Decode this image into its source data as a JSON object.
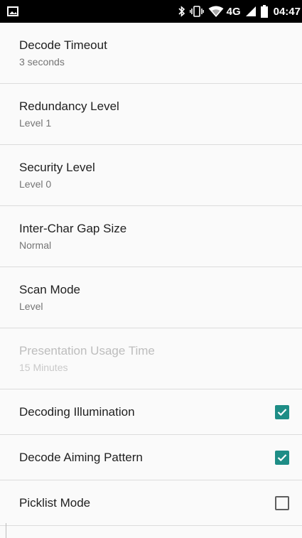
{
  "status_bar": {
    "network_label": "4G",
    "time": "04:47",
    "icons": [
      "image-notification-icon",
      "bluetooth-icon",
      "vibrate-icon",
      "wifi-icon",
      "cell-signal-icon",
      "battery-icon"
    ]
  },
  "colors": {
    "accent": "#1e8d86",
    "title": "#212121",
    "summary": "#757575",
    "disabled": "#bdbdbd",
    "divider": "#dcdcdc"
  },
  "preferences": [
    {
      "title": "Decode Timeout",
      "summary": "3 seconds",
      "enabled": true
    },
    {
      "title": "Redundancy Level",
      "summary": "Level 1",
      "enabled": true
    },
    {
      "title": "Security Level",
      "summary": "Level 0",
      "enabled": true
    },
    {
      "title": "Inter-Char Gap Size",
      "summary": "Normal",
      "enabled": true
    },
    {
      "title": "Scan Mode",
      "summary": "Level",
      "enabled": true
    },
    {
      "title": "Presentation Usage Time",
      "summary": "15 Minutes",
      "enabled": false
    }
  ],
  "checkbox_preferences": [
    {
      "title": "Decoding Illumination",
      "checked": true
    },
    {
      "title": "Decode Aiming Pattern",
      "checked": true
    },
    {
      "title": "Picklist Mode",
      "checked": false
    }
  ]
}
